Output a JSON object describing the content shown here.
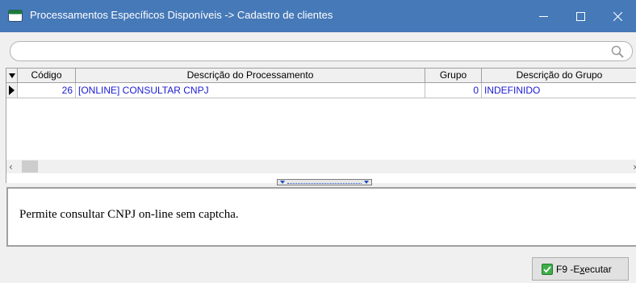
{
  "window": {
    "title": "Processamentos Específicos Disponíveis -> Cadastro de clientes",
    "minimize_icon": "minimize-icon",
    "maximize_icon": "maximize-icon",
    "close_icon": "close-icon",
    "title_bar_color": "#4679b8"
  },
  "search": {
    "value": "",
    "icon": "search-icon"
  },
  "grid": {
    "columns": [
      "Código",
      "Descrição do Processamento",
      "Grupo",
      "Descrição do Grupo"
    ],
    "rows": [
      {
        "codigo": "26",
        "descricao": "[ONLINE] CONSULTAR CNPJ",
        "grupo": "0",
        "descricao_grupo": "INDEFINIDO"
      }
    ],
    "row_text_color": "#1a1ad4"
  },
  "description": {
    "text": "Permite consultar CNPJ on-line sem captcha."
  },
  "actions": {
    "execute_key": "F9 - ",
    "execute_prefix": "E",
    "execute_mnemonic": "x",
    "execute_suffix": "ecutar",
    "execute_icon": "check-icon"
  }
}
